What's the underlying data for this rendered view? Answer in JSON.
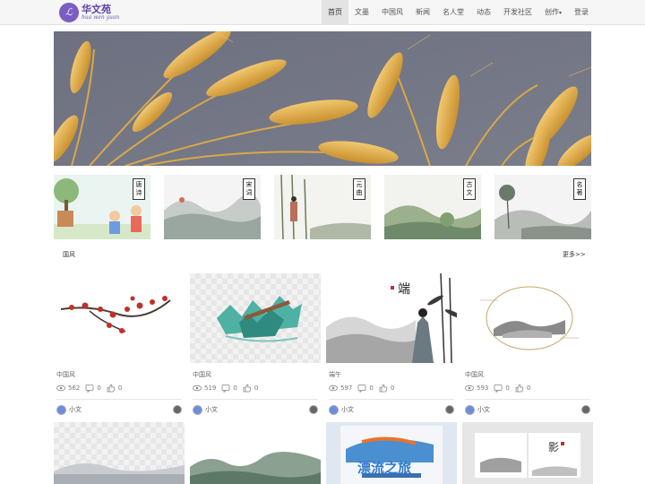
{
  "header": {
    "logo_cn": "华文苑",
    "logo_pinyin": "hua wen yuan",
    "nav": [
      {
        "label": "首页",
        "active": true
      },
      {
        "label": "文墨"
      },
      {
        "label": "中国风"
      },
      {
        "label": "新闻"
      },
      {
        "label": "名人堂"
      },
      {
        "label": "动态"
      },
      {
        "label": "开发社区"
      },
      {
        "label": "创作"
      },
      {
        "label": "登录"
      }
    ]
  },
  "categories": [
    {
      "label": "唐诗"
    },
    {
      "label": "宋词"
    },
    {
      "label": "元曲"
    },
    {
      "label": "古文"
    },
    {
      "label": "名著"
    }
  ],
  "section": {
    "title": "国风",
    "more": "更多>>"
  },
  "cards": [
    {
      "category": "中国风",
      "views": "562",
      "comments": "0",
      "likes": "0",
      "author": "小文"
    },
    {
      "category": "中国风",
      "views": "519",
      "comments": "0",
      "likes": "0",
      "author": "小文"
    },
    {
      "category": "端午",
      "views": "597",
      "comments": "0",
      "likes": "0",
      "author": "小文"
    },
    {
      "category": "中国风",
      "views": "593",
      "comments": "0",
      "likes": "0",
      "author": "小文"
    }
  ],
  "poster_text": "漂流之旅",
  "colors": {
    "accent": "#7b5cc4",
    "nav_bg": "#f6f6f6",
    "active_nav": "#e3e3e3"
  }
}
